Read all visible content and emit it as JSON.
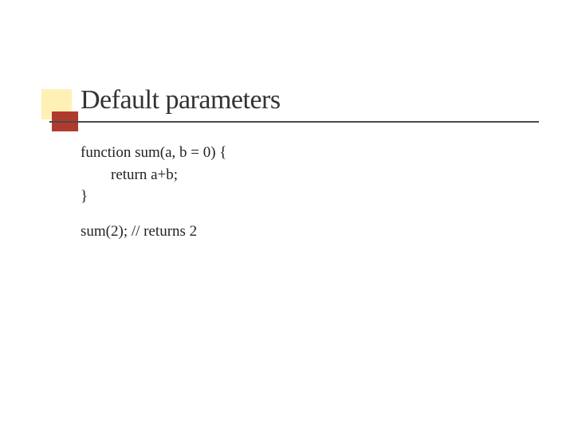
{
  "slide": {
    "title": "Default parameters",
    "code": {
      "line1": "function sum(a, b = 0) {",
      "line2": "        return a+b;",
      "line3": "}",
      "line4": "sum(2); // returns 2"
    }
  }
}
